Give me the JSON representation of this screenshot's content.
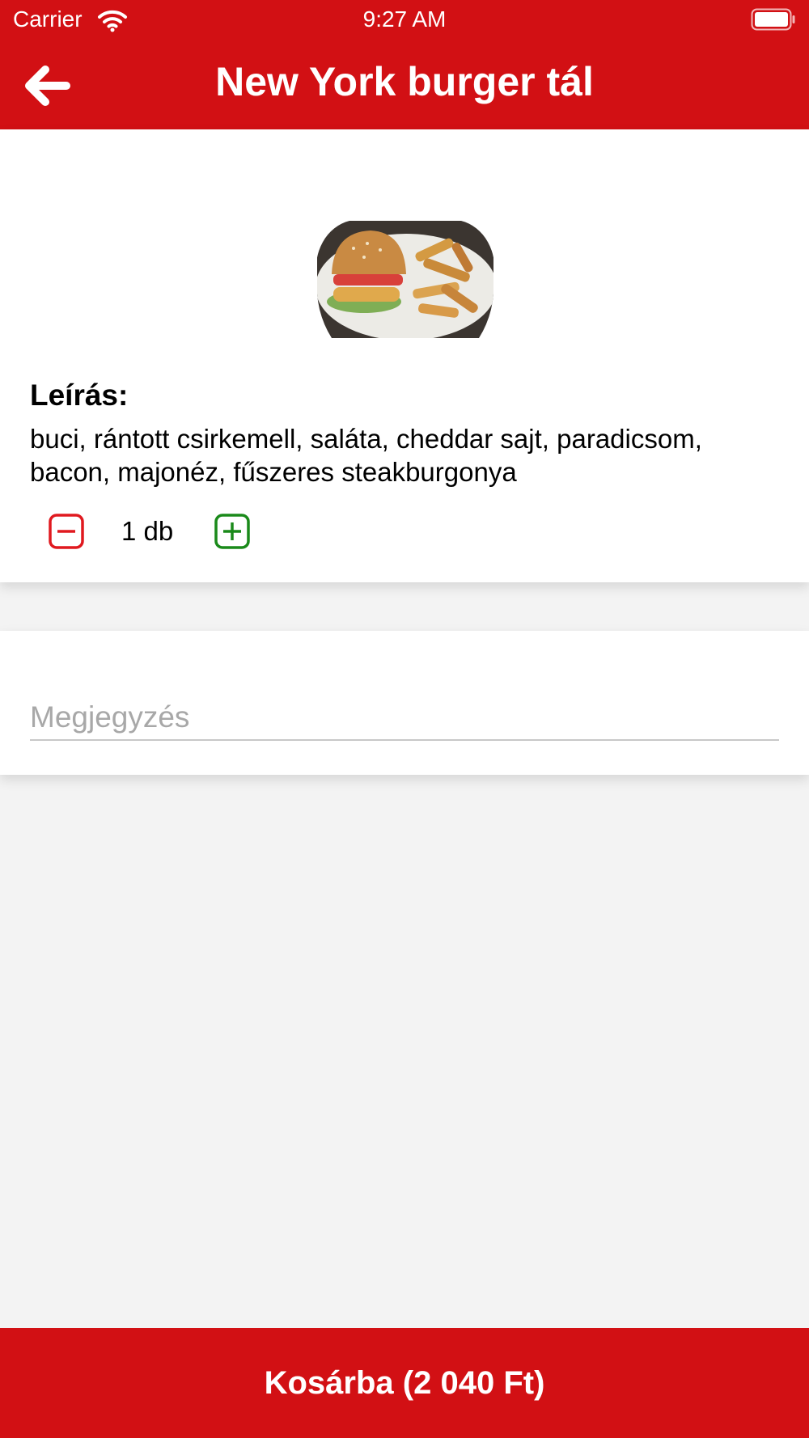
{
  "status_bar": {
    "carrier": "Carrier",
    "time": "9:27 AM"
  },
  "header": {
    "title": "New York burger tál",
    "back_icon": "arrow-left-icon"
  },
  "product": {
    "image": "burger-plate-photo",
    "description_label": "Leírás:",
    "description": "buci, rántott csirkemell, saláta, cheddar sajt, paradicsom, bacon, majonéz, fűszeres steakburgonya",
    "quantity": "1 db"
  },
  "note": {
    "placeholder": "Megjegyzés",
    "value": ""
  },
  "cart_button": {
    "label": "Kosárba (2 040 Ft)"
  },
  "colors": {
    "brand": "#d21014",
    "minus": "#e0191f",
    "plus": "#1a8a1a",
    "background": "#f3f3f3"
  }
}
